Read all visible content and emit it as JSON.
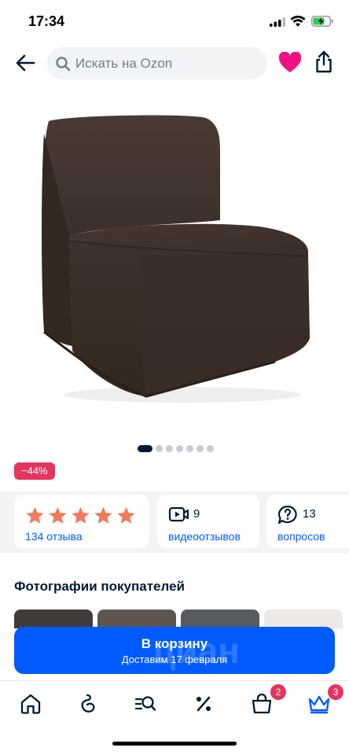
{
  "status_bar": {
    "time": "17:34"
  },
  "search": {
    "placeholder": "Искать на Ozon"
  },
  "gallery": {
    "total_images": 7,
    "active_index": 0
  },
  "product": {
    "discount_badge": "−44%"
  },
  "rating": {
    "stars": 5,
    "reviews_label": "134 отзыва"
  },
  "videos": {
    "count": "9",
    "label": "видеоотзывов"
  },
  "questions": {
    "count": "13",
    "label": "вопросов"
  },
  "buyer_photos": {
    "title": "Фотографии покупателей"
  },
  "cart_button": {
    "label": "В корзину",
    "delivery": "Доставим 17 февраля"
  },
  "watermark": {
    "text": "циан"
  },
  "nav": {
    "cart_badge": "2",
    "premium_badge": "3"
  },
  "colors": {
    "accent": "#005bff",
    "badge": "#e5355f",
    "star": "#f07a5a",
    "heart": "#f1117e"
  }
}
